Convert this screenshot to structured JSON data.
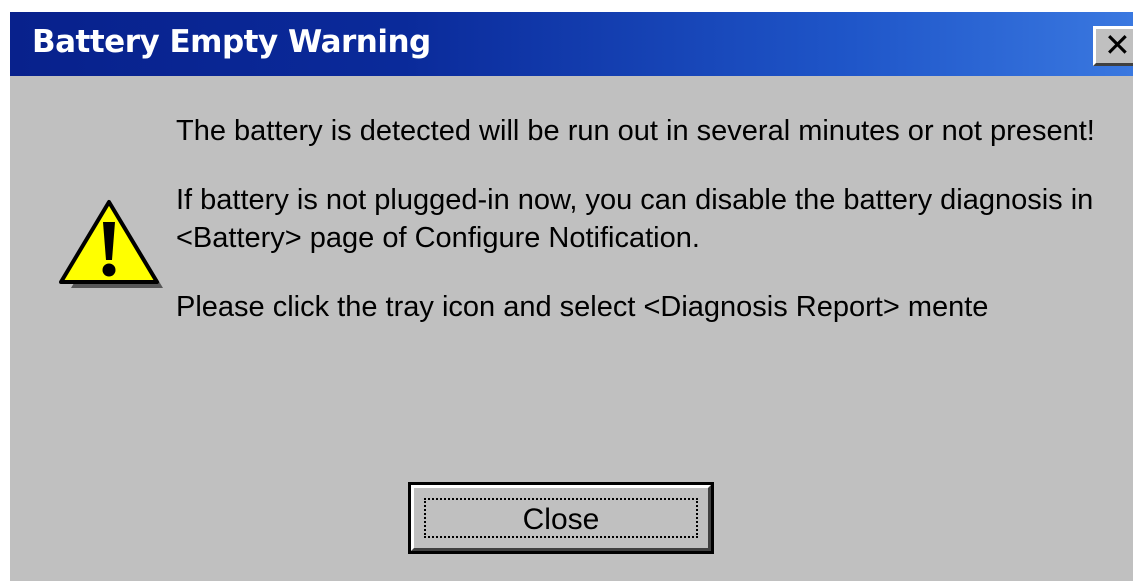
{
  "dialog": {
    "title": "Battery Empty Warning",
    "close_glyph": "✕",
    "icon": "warning-triangle-icon",
    "messages": [
      "The battery is detected will be run out in several minutes or not present!",
      "If battery is not plugged-in now, you can disable the battery diagnosis in <Battery> page of Configure Notification.",
      "Please click the tray icon and select <Diagnosis Report> mente"
    ],
    "close_button_label": "Close"
  },
  "colors": {
    "title_bar_start": "#08218c",
    "title_bar_end": "#3a78e0",
    "dialog_face": "#c0c0c0",
    "warning_yellow": "#ffff00"
  }
}
